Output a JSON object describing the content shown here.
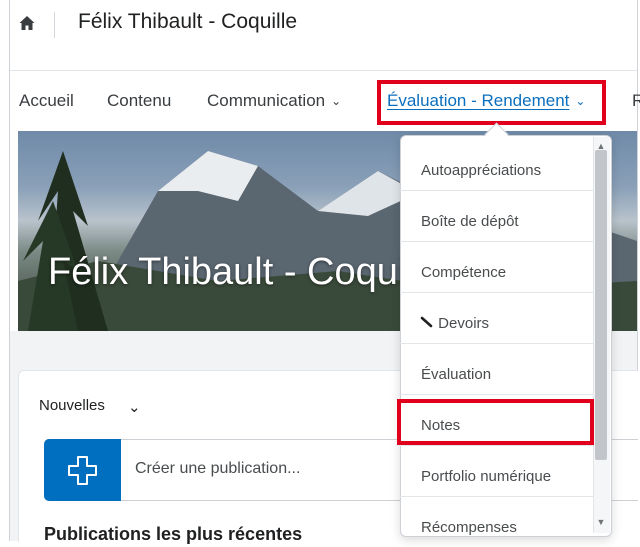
{
  "course": {
    "title": "Félix Thibault - Coquille",
    "banner_title": "Félix Thibault - Coquille"
  },
  "nav": {
    "items": [
      {
        "label": "Accueil"
      },
      {
        "label": "Contenu"
      },
      {
        "label": "Communication"
      },
      {
        "label": "Évaluation - Rendement"
      },
      {
        "label": "R"
      }
    ]
  },
  "dropdown": {
    "items": [
      {
        "label": "Autoappréciations"
      },
      {
        "label": "Boîte de dépôt"
      },
      {
        "label": "Compétence"
      },
      {
        "label": "Devoirs"
      },
      {
        "label": "Évaluation"
      },
      {
        "label": "Notes"
      },
      {
        "label": "Portfolio numérique"
      },
      {
        "label": "Récompenses"
      }
    ]
  },
  "news": {
    "label": "Nouvelles",
    "create_label": "Créer une publication...",
    "recent_title": "Publications les plus récentes"
  },
  "colors": {
    "accent": "#006fbf",
    "highlight": "#e0001b",
    "link": "#0b6fbf"
  },
  "icons": {
    "home": "home-icon",
    "chevron": "chevron-down-icon",
    "create": "plus-icon",
    "devoirs": "pencil-icon"
  }
}
